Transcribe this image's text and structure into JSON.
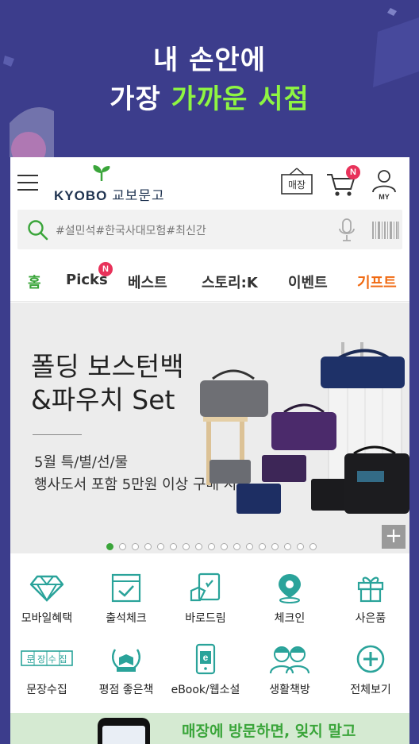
{
  "hero": {
    "line1": "내 손안에",
    "line2_prefix": "가장 ",
    "line2_highlight": "가까운 서점"
  },
  "header": {
    "logo_text": "KYOBO",
    "logo_korean": "교보문고",
    "store_label": "매장",
    "cart_badge": "N",
    "my_label": "MY"
  },
  "search": {
    "placeholder": "#설민석#한국사대모험#최신간"
  },
  "tabs": [
    {
      "label": "홈"
    },
    {
      "label": "Picks",
      "badge": "N"
    },
    {
      "label": "베스트"
    },
    {
      "label": "스토리:K"
    },
    {
      "label": "이벤트"
    },
    {
      "label": "기프트"
    }
  ],
  "banner": {
    "title_line1": "폴딩 보스턴백",
    "title_line2": "&파우치 Set",
    "sub_line1": "5월 특/별/선/물",
    "sub_line2": "행사도서 포함 5만원 이상 구매 시",
    "slide_count": 17,
    "active_slide": 1,
    "plus": "+"
  },
  "menu": [
    {
      "label": "모바일혜택",
      "icon": "diamond-icon"
    },
    {
      "label": "출석체크",
      "icon": "calendar-check-icon"
    },
    {
      "label": "바로드림",
      "icon": "hand-book-icon"
    },
    {
      "label": "체크인",
      "icon": "location-pin-icon"
    },
    {
      "label": "사은품",
      "icon": "gift-icon"
    },
    {
      "label": "문장수집",
      "icon": "sentence-collect-icon",
      "icon_text": "문 장 수 집"
    },
    {
      "label": "평점 좋은책",
      "icon": "laurel-book-icon"
    },
    {
      "label": "eBook/웹소설",
      "icon": "ebook-phone-icon",
      "icon_text": "e"
    },
    {
      "label": "생활책방",
      "icon": "people-icon"
    },
    {
      "label": "전체보기",
      "icon": "plus-circle-icon"
    }
  ],
  "promo": {
    "text": "매장에 방문하면, 잊지 말고"
  },
  "colors": {
    "background": "#3c3d8c",
    "accent_green": "#3aa53a",
    "hero_highlight": "#8ef542",
    "gift_orange": "#f06a12",
    "badge_pink": "#e8325a"
  }
}
